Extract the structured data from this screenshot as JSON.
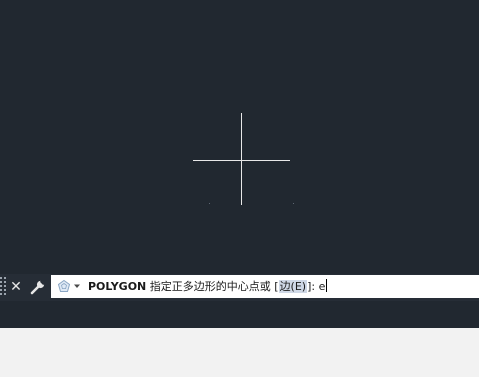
{
  "colors": {
    "canvas": "#212830",
    "command_bar": "#262d36",
    "command_input": "#ffffff",
    "option_highlight": "#cfd8e6",
    "crosshair": "#e8e8e8",
    "bottom_panel": "#f2f2f2"
  },
  "command_bar": {
    "close_glyph": "✕",
    "icons": [
      "grip-handle-icon",
      "close-icon",
      "wrench-icon",
      "polygon-icon",
      "dropdown-arrow-icon"
    ]
  },
  "command_line": {
    "command_name": "POLYGON",
    "prompt_text": " 指定正多边形的中心点或 [",
    "option_label": "边(E)",
    "prompt_suffix": "]: ",
    "input_value": "e"
  }
}
